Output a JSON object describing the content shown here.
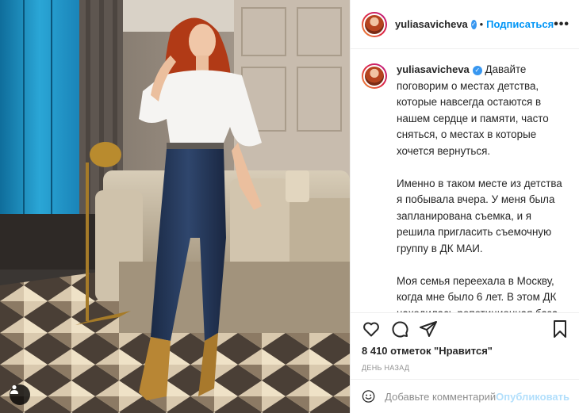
{
  "post": {
    "author": "yuliasavicheva",
    "verified": true,
    "follow_label": "Подписаться",
    "more_label": "•••",
    "caption_paragraphs": [
      "Давайте поговорим о местах детства, которые навсегда остаются в нашем сердце и памяти, часто сняться, о местах в которые хочется вернуться.",
      "Именно в таком месте из детства я побывала вчера. У меня была запланирована съемка, и я решила пригласить съемочную группу в ДК МАИ.",
      "Моя семья переехала в Москву, когда мне было 6 лет. В этом ДК находилась репетиционная база группы Конвой, в которой мой папа был барабанщиком, а солистом Максим Фадеев. Мама попутно устроилась на работу заведующей детским садом. Здесь же в подшефном"
    ],
    "likes_text": "8 410 отметок \"Нравится\"",
    "time_text": "День назад"
  },
  "comment_box": {
    "placeholder": "Добавьте комментарий...",
    "publish_label": "Опубликовать"
  },
  "icons": {
    "like": "heart-icon",
    "comment": "comment-icon",
    "share": "share-icon",
    "save": "bookmark-icon",
    "emoji": "emoji-icon",
    "tag": "user-tag-icon",
    "verified": "verified-badge-icon"
  },
  "colors": {
    "link_blue": "#0095f6",
    "publish_disabled": "#b2dffc",
    "verified_blue": "#3897f0",
    "muted": "#8e8e8e",
    "text": "#262626"
  }
}
